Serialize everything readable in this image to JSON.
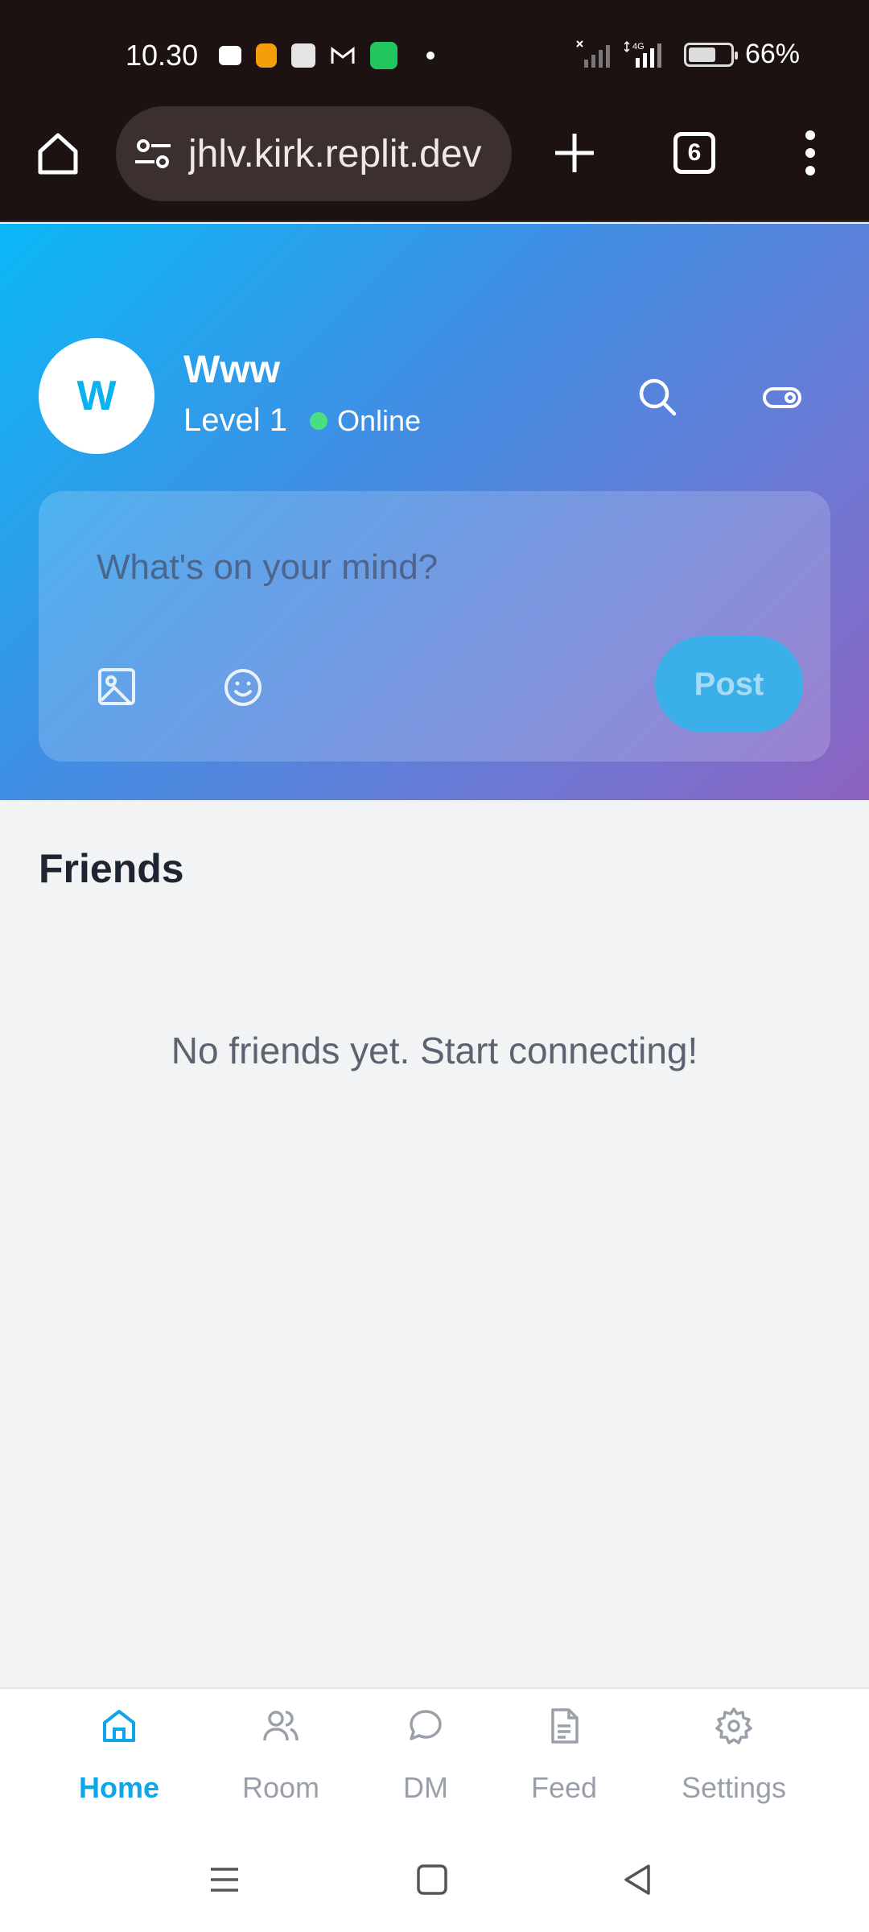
{
  "status_bar": {
    "time": "10.30",
    "battery_percent": "66%",
    "battery_level": 0.66,
    "network": "4G",
    "notification_icons": [
      "wallet-icon",
      "j-app-icon",
      "news-app-icon",
      "gmail-icon",
      "phone-icon"
    ]
  },
  "browser": {
    "url": "jhlv.kirk.replit.dev",
    "tab_count": "6"
  },
  "profile": {
    "avatar_initial": "W",
    "name": "Www",
    "level": "Level 1",
    "status": "Online"
  },
  "composer": {
    "placeholder": "What's on your mind?",
    "post_label": "Post"
  },
  "friends": {
    "title": "Friends",
    "empty_message": "No friends yet. Start connecting!"
  },
  "nav": {
    "items": [
      {
        "label": "Home",
        "icon": "home-icon",
        "active": true
      },
      {
        "label": "Room",
        "icon": "users-icon",
        "active": false
      },
      {
        "label": "DM",
        "icon": "chat-bubble-icon",
        "active": false
      },
      {
        "label": "Feed",
        "icon": "document-icon",
        "active": false
      },
      {
        "label": "Settings",
        "icon": "gear-icon",
        "active": false
      }
    ]
  },
  "colors": {
    "accent": "#0ea5e9",
    "online": "#4ade80",
    "gradient_start": "#0bb8f7",
    "gradient_end": "#8d62c1"
  }
}
